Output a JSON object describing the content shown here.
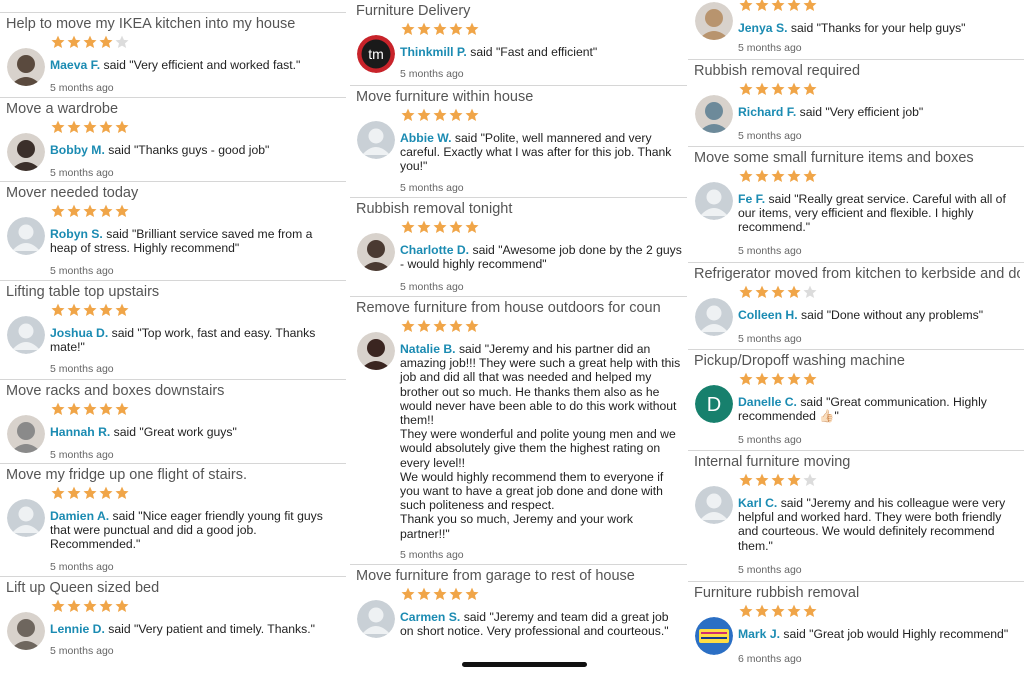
{
  "reviews": [
    {
      "title": "Help to move my IKEA kitchen into my house",
      "rating": 4,
      "name": "Maeva F.",
      "said": "said",
      "text": "\"Very efficient and worked fast.\"",
      "time": "5 months ago",
      "avatar": "photo",
      "avatar_color": "#5a4a3e"
    },
    {
      "title": "Move a wardrobe",
      "rating": 5,
      "name": "Bobby M.",
      "said": "said",
      "text": "\"Thanks guys - good job\"",
      "time": "5 months ago",
      "avatar": "photo",
      "avatar_color": "#3b2f2a"
    },
    {
      "title": "Mover needed today",
      "rating": 5,
      "name": "Robyn S.",
      "said": "said",
      "text": "\"Brilliant service saved me from a heap of stress.  Highly recommend\"",
      "time": "5 months ago",
      "avatar": "placeholder"
    },
    {
      "title": "Lifting table top upstairs",
      "rating": 5,
      "name": "Joshua D.",
      "said": "said",
      "text": "\"Top work, fast and easy. Thanks mate!\"",
      "time": "5 months ago",
      "avatar": "placeholder"
    },
    {
      "title": "Move racks and boxes downstairs",
      "rating": 5,
      "name": "Hannah R.",
      "said": "said",
      "text": "\"Great work guys\"",
      "time": "5 months ago",
      "avatar": "photo",
      "avatar_color": "#8a8a8a"
    },
    {
      "title": "Move my fridge up one flight of stairs.",
      "rating": 5,
      "name": "Damien  A.",
      "said": "said",
      "text": "\"Nice eager friendly young fit guys that were punctual and did a good job. Recommended.\"",
      "time": "5 months ago",
      "avatar": "placeholder"
    },
    {
      "title": "Lift up Queen sized bed",
      "rating": 5,
      "name": "Lennie D.",
      "said": "said",
      "text": "\"Very patient and timely. Thanks.\"",
      "time": "5 months ago",
      "avatar": "photo",
      "avatar_color": "#6e665e"
    },
    {
      "title": "Furniture Delivery",
      "rating": 5,
      "name": "Thinkmill P.",
      "said": "said",
      "text": "\"Fast and efficient\"",
      "time": "5 months ago",
      "avatar": "logo",
      "logo_text": "tm",
      "avatar_color": "#c8232a"
    },
    {
      "title": "Move furniture within house",
      "rating": 5,
      "name": "Abbie W.",
      "said": "said",
      "text": "\"Polite, well mannered and very careful. Exactly what I was after for this job. Thank you!\"",
      "time": "5 months ago",
      "avatar": "placeholder"
    },
    {
      "title": "Rubbish removal tonight",
      "rating": 5,
      "name": "Charlotte D.",
      "said": "said",
      "text": "\"Awesome job done by the 2 guys - would highly recommend\"",
      "time": "5 months ago",
      "avatar": "photo",
      "avatar_color": "#4a3a32"
    },
    {
      "title": "Remove furniture from house outdoors for coun",
      "rating": 5,
      "name": "Natalie B.",
      "said": "said",
      "text": "\"Jeremy and his partner did an amazing job!!!  They were such a great help with this job and did all that was needed and helped my brother out so much.  He thanks them also as he would  never have  been able to do this work without them!!\nThey were wonderful and polite young men and we would absolutely give them the highest rating on every level!!\nWe would highly recommend them to everyone if you want to have a great job done and done with such politeness and respect.\nThank you so much, Jeremy and your work partner!!\"",
      "time": "5 months ago",
      "avatar": "photo",
      "avatar_color": "#3a2520"
    },
    {
      "title": "Move furniture from garage to rest of house",
      "rating": 5,
      "name": "Carmen S.",
      "said": "said",
      "text": "\"Jeremy and team did a great job on short notice. Very professional and courteous.\"",
      "time": "",
      "avatar": "placeholder"
    },
    {
      "title": "",
      "rating": 5,
      "name": "Jenya S.",
      "said": "said",
      "text": "\"Thanks for your help guys\"",
      "time": "5 months ago",
      "avatar": "photo",
      "avatar_color": "#b8946e"
    },
    {
      "title": "Rubbish removal required",
      "rating": 5,
      "name": "Richard F.",
      "said": "said",
      "text": "\"Very efficient job\"",
      "time": "5 months ago",
      "avatar": "photo",
      "avatar_color": "#6d8a9a"
    },
    {
      "title": "Move some small furniture items and boxes",
      "rating": 5,
      "name": "Fe F.",
      "said": "said",
      "text": "\"Really great service. Careful with all of our items, very efficient and flexible. I highly recommend.\"",
      "time": "5 months ago",
      "avatar": "placeholder"
    },
    {
      "title": "Refrigerator moved from kitchen to kerbside and do",
      "rating": 4,
      "name": "Colleen H.",
      "said": "said",
      "text": "\"Done without any problems\"",
      "time": "5 months ago",
      "avatar": "placeholder"
    },
    {
      "title": "Pickup/Dropoff washing machine",
      "rating": 5,
      "name": "Danelle  C.",
      "said": "said",
      "text": "\"Great communication. Highly recommended 👍🏻\"",
      "time": "5 months ago",
      "avatar": "initial",
      "initial": "D",
      "avatar_color": "#17806d"
    },
    {
      "title": "Internal furniture moving",
      "rating": 4,
      "name": "Karl C.",
      "said": "said",
      "text": "\"Jeremy and his colleague were very helpful and worked hard. They were both friendly and courteous. We would definitely recommend them.\"",
      "time": "5 months ago",
      "avatar": "placeholder"
    },
    {
      "title": "Furniture rubbish removal",
      "rating": 5,
      "name": "Mark J.",
      "said": "said",
      "text": "\"Great job would Highly recommend\"",
      "time": "6 months ago",
      "avatar": "logo",
      "logo_text": "Aussie Kids PARTIES",
      "avatar_color": "#2b6fc4"
    }
  ],
  "colors": {
    "star_filled": "#f0a548",
    "star_empty": "#dcdcdc",
    "name": "#1b8bb2"
  }
}
